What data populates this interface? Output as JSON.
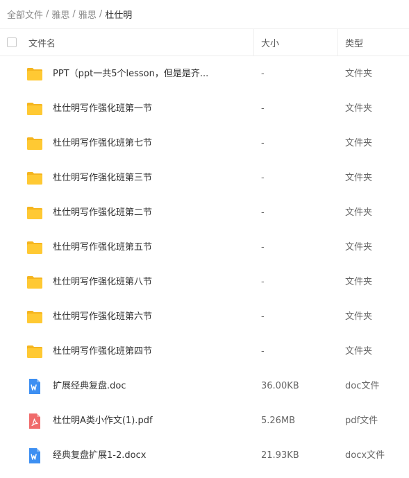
{
  "breadcrumb": {
    "items": [
      "全部文件",
      "雅思",
      "雅思",
      "杜仕明"
    ],
    "separator": "/"
  },
  "header": {
    "name": "文件名",
    "size": "大小",
    "type": "类型"
  },
  "colors": {
    "folder": "#FFC933",
    "folder_back": "#F5B51F",
    "word": "#3D8FF2",
    "pdf": "#F06B6B"
  },
  "files": [
    {
      "icon": "folder-icon",
      "name": "PPT（ppt一共5个lesson，但是是齐...",
      "size": "-",
      "type": "文件夹"
    },
    {
      "icon": "folder-icon",
      "name": "杜仕明写作强化班第一节",
      "size": "-",
      "type": "文件夹"
    },
    {
      "icon": "folder-icon",
      "name": "杜仕明写作强化班第七节",
      "size": "-",
      "type": "文件夹"
    },
    {
      "icon": "folder-icon",
      "name": "杜仕明写作强化班第三节",
      "size": "-",
      "type": "文件夹"
    },
    {
      "icon": "folder-icon",
      "name": "杜仕明写作强化班第二节",
      "size": "-",
      "type": "文件夹"
    },
    {
      "icon": "folder-icon",
      "name": "杜仕明写作强化班第五节",
      "size": "-",
      "type": "文件夹"
    },
    {
      "icon": "folder-icon",
      "name": "杜仕明写作强化班第八节",
      "size": "-",
      "type": "文件夹"
    },
    {
      "icon": "folder-icon",
      "name": "杜仕明写作强化班第六节",
      "size": "-",
      "type": "文件夹"
    },
    {
      "icon": "folder-icon",
      "name": "杜仕明写作强化班第四节",
      "size": "-",
      "type": "文件夹"
    },
    {
      "icon": "word-doc-icon",
      "name": "扩展经典复盘.doc",
      "size": "36.00KB",
      "type": "doc文件"
    },
    {
      "icon": "pdf-icon",
      "name": "杜仕明A类小作文(1).pdf",
      "size": "5.26MB",
      "type": "pdf文件"
    },
    {
      "icon": "word-doc-icon",
      "name": "经典复盘扩展1-2.docx",
      "size": "21.93KB",
      "type": "docx文件"
    }
  ]
}
